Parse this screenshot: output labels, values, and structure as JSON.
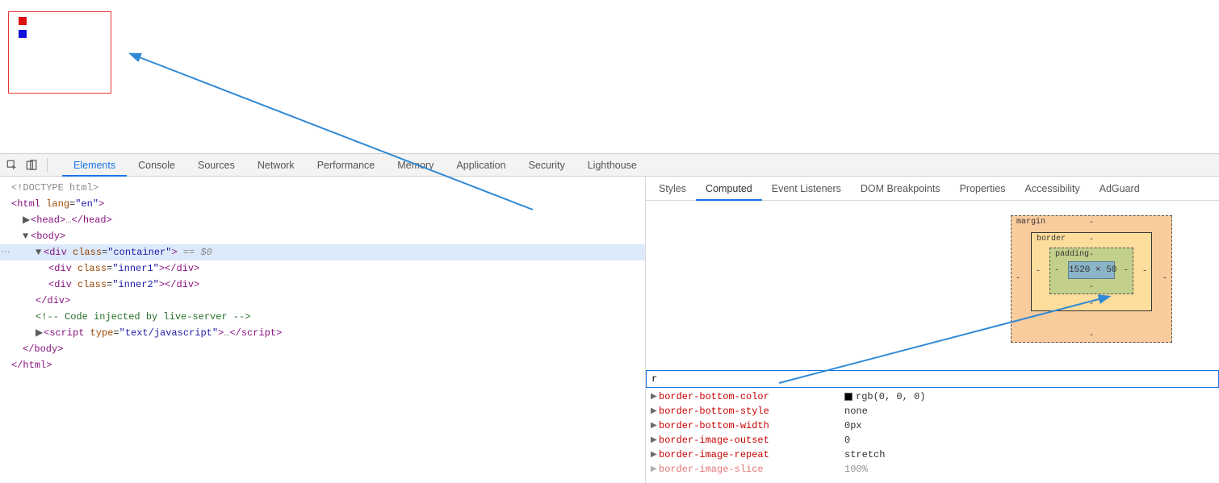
{
  "tabs": {
    "elements": "Elements",
    "console": "Console",
    "sources": "Sources",
    "network": "Network",
    "performance": "Performance",
    "memory": "Memory",
    "application": "Application",
    "security": "Security",
    "lighthouse": "Lighthouse"
  },
  "dom": {
    "doctype": "<!DOCTYPE html>",
    "html_open": "<html lang=\"en\">",
    "head": "<head>…</head>",
    "body_open": "<body>",
    "container": "<div class=\"container\">",
    "selmark": " == $0",
    "inner1": "<div class=\"inner1\"></div>",
    "inner2": "<div class=\"inner2\"></div>",
    "div_close": "</div>",
    "comment": "<!-- Code injected by live-server -->",
    "script": "<script type=\"text/javascript\">…</scr",
    "script_tail": "ipt>",
    "body_close": "</body>",
    "html_close": "</html>"
  },
  "side_tabs": {
    "styles": "Styles",
    "computed": "Computed",
    "event_listeners": "Event Listeners",
    "dom_breakpoints": "DOM Breakpoints",
    "properties": "Properties",
    "accessibility": "Accessibility",
    "adguard": "AdGuard"
  },
  "boxmodel": {
    "margin": "margin",
    "border": "border",
    "padding": "padding",
    "content": "1520 × 50",
    "dash": "-"
  },
  "filter": {
    "value": "r"
  },
  "props": [
    {
      "name": "border-bottom-color",
      "value": "rgb(0, 0, 0)",
      "swatch": true
    },
    {
      "name": "border-bottom-style",
      "value": "none"
    },
    {
      "name": "border-bottom-width",
      "value": "0px"
    },
    {
      "name": "border-image-outset",
      "value": "0"
    },
    {
      "name": "border-image-repeat",
      "value": "stretch"
    },
    {
      "name": "border-image-slice",
      "value": "100%"
    }
  ]
}
